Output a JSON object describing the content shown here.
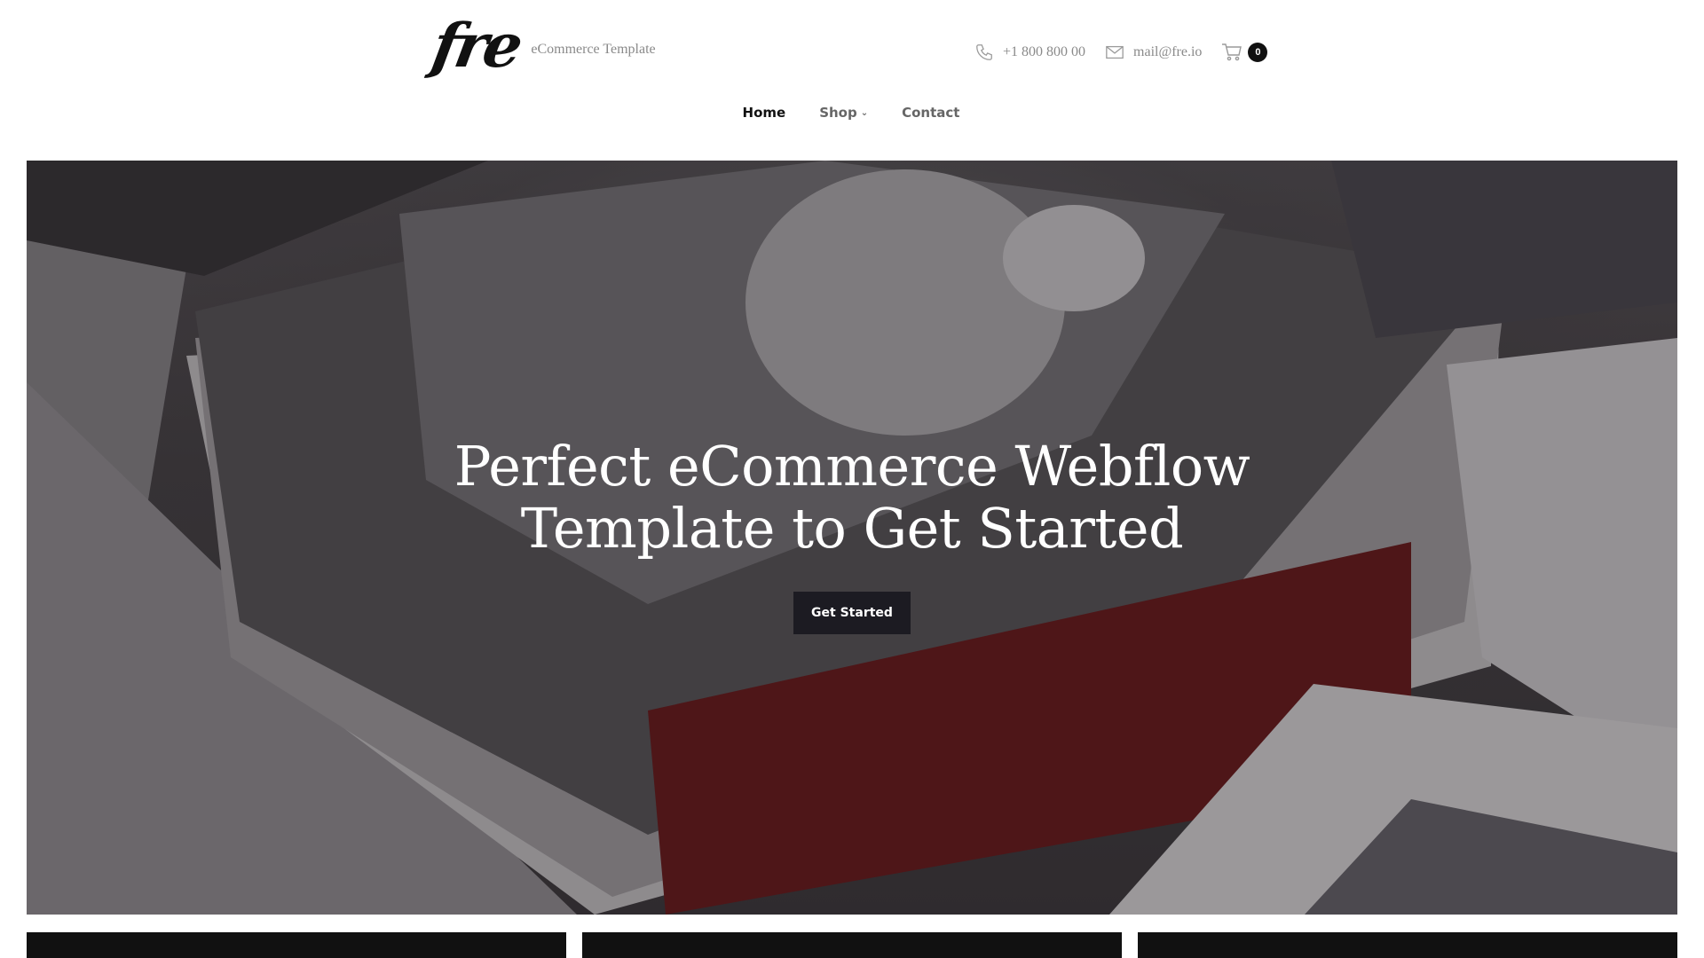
{
  "header": {
    "logo_text": "fre",
    "tagline": "eCommerce Template",
    "phone": "+1 800 800 00",
    "email": "mail@fre.io",
    "cart_count": "0"
  },
  "nav": {
    "items": [
      {
        "label": "Home"
      },
      {
        "label": "Shop"
      },
      {
        "label": "Contact"
      }
    ]
  },
  "hero": {
    "title_line1": "Perfect eCommerce Webflow",
    "title_line2": "Template to Get Started",
    "button_label": "Get Started"
  },
  "colors": {
    "accent": "#1c1b22",
    "text_muted": "#8a8a8a",
    "dark": "#111111"
  },
  "icons": [
    "phone-icon",
    "mail-icon",
    "cart-icon",
    "chevron-down-icon"
  ]
}
